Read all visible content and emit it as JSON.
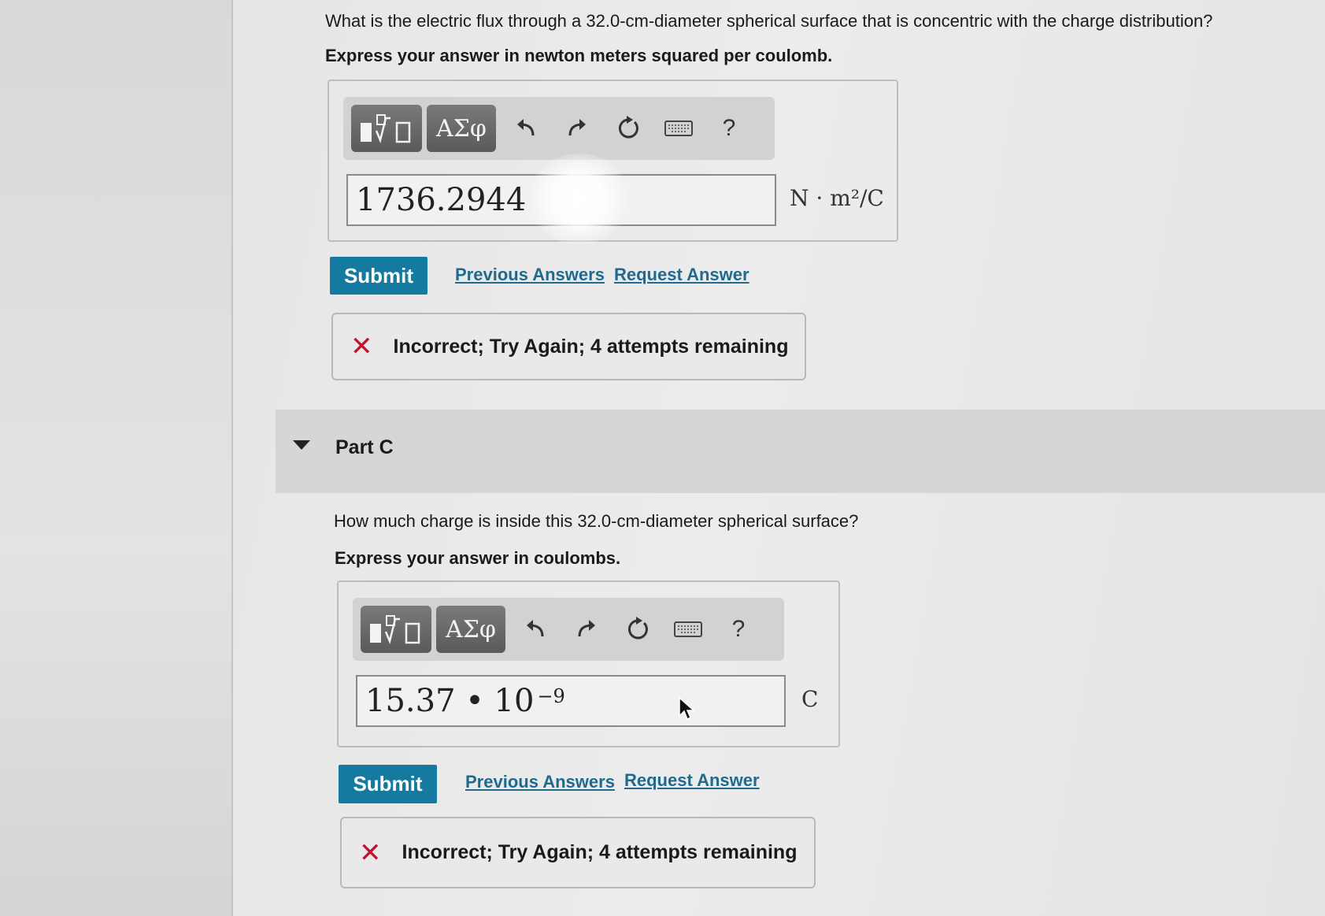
{
  "part_b": {
    "question": "What is the electric flux through a 32.0-cm-diameter spherical surface that is concentric with the charge distribution?",
    "instruction": "Express your answer in newton meters squared per coulomb.",
    "toolbar": {
      "templates_icon": "templates-icon",
      "greek_label": "ΑΣφ",
      "help_label": "?"
    },
    "input_value": "1736.2944",
    "unit": "N · m²/C",
    "submit_label": "Submit",
    "previous_answers_label": "Previous Answers",
    "request_answer_label": "Request Answer",
    "feedback": "Incorrect; Try Again; 4 attempts remaining",
    "feedback_color": "#c8102e"
  },
  "part_c": {
    "title": "Part C",
    "question": "How much charge is inside this 32.0-cm-diameter spherical surface?",
    "instruction": "Express your answer in coulombs.",
    "toolbar": {
      "templates_icon": "templates-icon",
      "greek_label": "ΑΣφ",
      "help_label": "?"
    },
    "input_mantissa": "15.37 • 10",
    "input_exponent": "−9",
    "unit": "C",
    "submit_label": "Submit",
    "previous_answers_label": "Previous Answers",
    "request_answer_label": "Request Answer",
    "feedback": "Incorrect; Try Again; 4 attempts remaining",
    "feedback_color": "#c8102e"
  },
  "colors": {
    "submit": "#157aa0",
    "link": "#1f6a8e",
    "error": "#c8102e"
  }
}
